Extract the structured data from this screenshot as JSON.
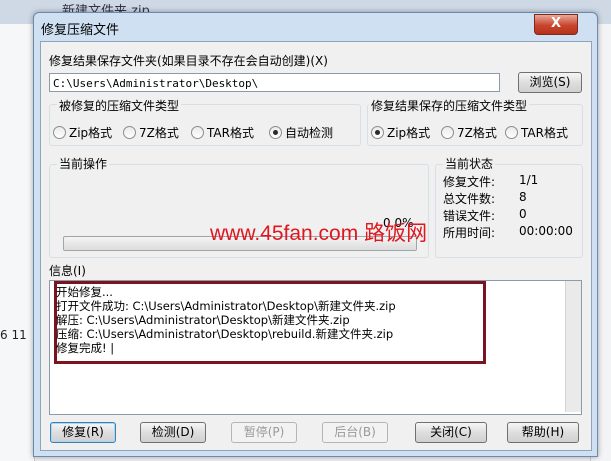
{
  "background": {
    "title": "新建文件夹.zip",
    "fragment": "6 11"
  },
  "dialog": {
    "title": "修复压缩文件",
    "close_label": "X",
    "save_path_label": "修复结果保存文件夹(如果目录不存在会自动创建)(X)",
    "save_path_value": "C:\\Users\\Administrator\\Desktop\\",
    "browse_label": "浏览(S)",
    "repair_type_group": {
      "label": "被修复的压缩文件类型",
      "options": [
        "Zip格式",
        "7Z格式",
        "TAR格式",
        "自动检测"
      ],
      "selected": "自动检测"
    },
    "save_type_group": {
      "label": "修复结果保存的压缩文件类型",
      "options": [
        "Zip格式",
        "7Z格式",
        "TAR格式"
      ],
      "selected": "Zip格式"
    },
    "current_operation": {
      "label": "当前操作",
      "percent_text": "0.0%",
      "progress": 0.0
    },
    "current_status": {
      "label": "当前状态",
      "rows": [
        {
          "key": "修复文件:",
          "value": "1/1"
        },
        {
          "key": "总文件数:",
          "value": "8"
        },
        {
          "key": "错误文件:",
          "value": "0"
        },
        {
          "key": "所用时间:",
          "value": "00:00:00"
        }
      ]
    },
    "info": {
      "label": "信息(I)",
      "lines": [
        "开始修复...",
        "打开文件成功: C:\\Users\\Administrator\\Desktop\\新建文件夹.zip",
        "解压: C:\\Users\\Administrator\\Desktop\\新建文件夹.zip",
        "压缩: C:\\Users\\Administrator\\Desktop\\rebuild.新建文件夹.zip",
        "修复完成! |"
      ]
    },
    "buttons": {
      "repair": "修复(R)",
      "detect": "检测(D)",
      "pause": "暂停(P)",
      "background": "后台(B)",
      "close": "关闭(C)",
      "help": "帮助(H)"
    },
    "watermark": "www.45fan.com 路饭网",
    "accent_color": "#7a1420"
  }
}
